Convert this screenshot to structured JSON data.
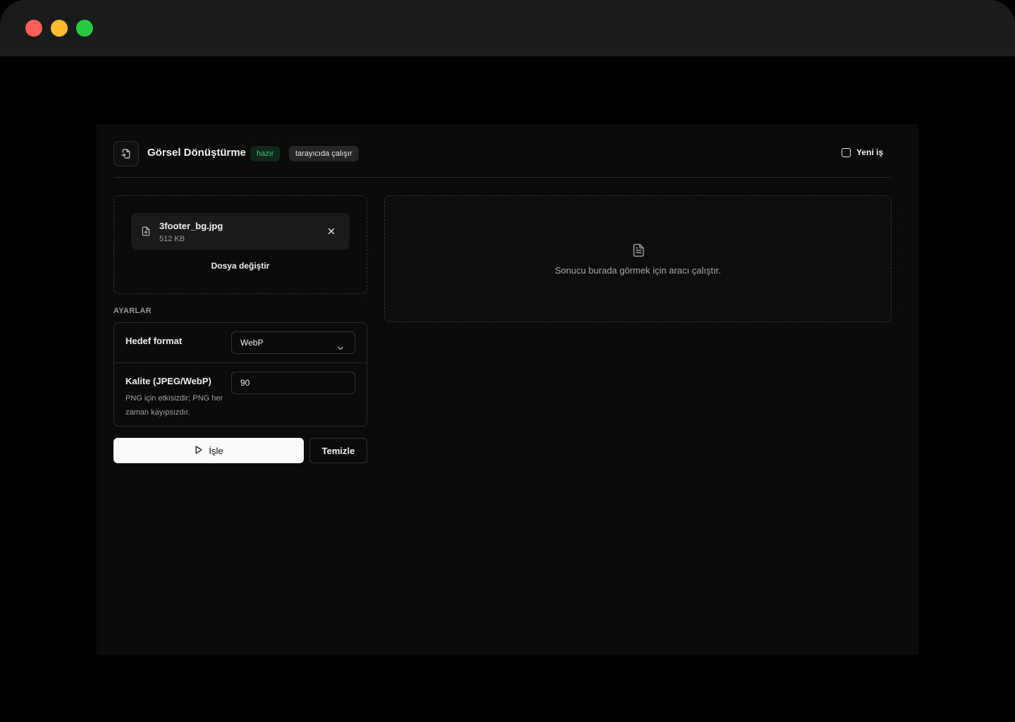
{
  "header": {
    "title": "Görsel Dönüştürme",
    "status_badge": "hazır",
    "runtime_badge": "tarayıcıda çalışır",
    "new_job_label": "Yeni iş"
  },
  "file": {
    "name": "3footer_bg.jpg",
    "size": "512 KB",
    "change_label": "Dosya değiştir"
  },
  "settings": {
    "section_label": "AYARLAR",
    "format_label": "Hedef format",
    "format_value": "WebP",
    "quality_label": "Kalite (JPEG/WebP)",
    "quality_hint": "PNG için etkisizdir; PNG her zaman kayıpsızdır.",
    "quality_value": "90"
  },
  "actions": {
    "run_label": "İşle",
    "clear_label": "Temizle"
  },
  "result": {
    "placeholder": "Sonucu burada görmek için aracı çalıştır."
  },
  "colors": {
    "ready_badge_text": "#37c77a",
    "panel_bg": "#0a0a0a"
  }
}
